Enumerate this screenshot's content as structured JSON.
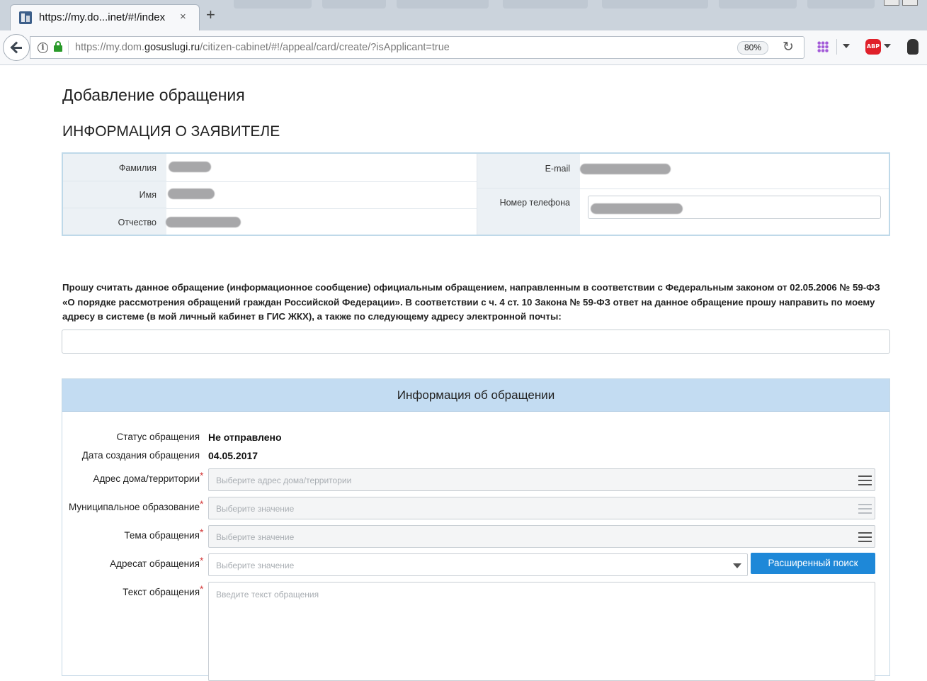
{
  "browser": {
    "tab_title": "https://my.do...inet/#!/index",
    "tab_close": "×",
    "new_tab": "+",
    "url_prefix": "https://my.dom.",
    "url_domain": "gosuslugi.ru",
    "url_suffix": "/citizen-cabinet/#!/appeal/card/create/?isApplicant=true",
    "zoom": "80%",
    "reload_icon": "↻",
    "info_icon": "i",
    "abp_label": "ABP",
    "icons": [
      "back-icon",
      "info-icon",
      "lock-icon",
      "reload-icon",
      "apps-grid-icon",
      "adblock-icon",
      "evernote-icon"
    ]
  },
  "page": {
    "title": "Добавление обращения",
    "section_title": "ИНФОРМАЦИЯ О ЗАЯВИТЕЛЕ"
  },
  "applicant": {
    "surname_label": "Фамилия",
    "name_label": "Имя",
    "patronymic_label": "Отчество",
    "email_label": "E-mail",
    "phone_label": "Номер телефона"
  },
  "request_text": "Прошу считать данное обращение (информационное сообщение) официальным обращением, направленным в соответствии с Федеральным законом от 02.05.2006 № 59-ФЗ «О порядке рассмотрения обращений граждан Российской Федерации». В соответствии с ч. 4 ст. 10 Закона № 59-ФЗ ответ на данное обращение прошу направить по моему адресу в системе (в мой личный кабинет в ГИС ЖКХ), а также по следующему адресу электронной почты:",
  "appeal": {
    "header": "Информация об обращении",
    "status_label": "Статус обращения",
    "status_value": "Не отправлено",
    "date_label": "Дата создания обращения",
    "date_value": "04.05.2017",
    "address_label": "Адрес дома/территории",
    "address_placeholder": "Выберите адрес дома/территории",
    "municipality_label": "Муниципальное образование",
    "municipality_placeholder": "Выберите значение",
    "topic_label": "Тема обращения",
    "topic_placeholder": "Выберите значение",
    "addressee_label": "Адресат обращения",
    "addressee_placeholder": "Выберите значение",
    "advanced_search": "Расширенный поиск",
    "text_label": "Текст обращения",
    "text_placeholder": "Введите текст обращения",
    "required_mark": "*"
  },
  "colors": {
    "accent": "#1e88d8",
    "panel_header": "#c3dcf2",
    "required": "#d43a3a"
  }
}
